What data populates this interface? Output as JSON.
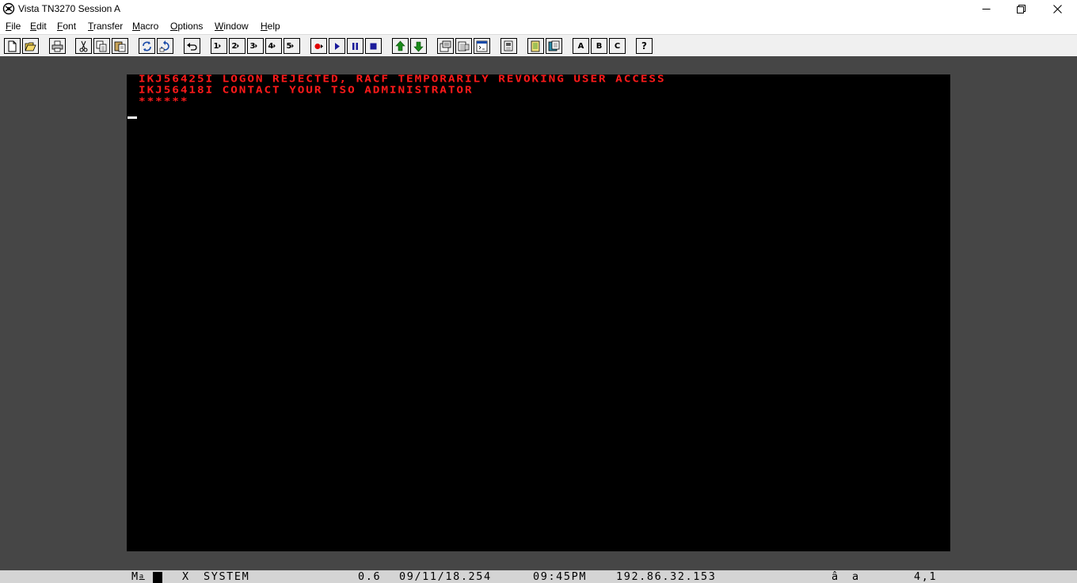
{
  "window": {
    "title": "Vista TN3270 Session A",
    "icon": "terminal-app-icon"
  },
  "menu": [
    {
      "label": "File",
      "key": "F",
      "rest": "ile"
    },
    {
      "label": "Edit",
      "key": "E",
      "rest": "dit"
    },
    {
      "label": "Font",
      "key": "F",
      "rest": "ont"
    },
    {
      "label": "Transfer",
      "key": "T",
      "rest": "ransfer"
    },
    {
      "label": "Macro",
      "key": "M",
      "rest": "acro"
    },
    {
      "label": "Options",
      "key": "O",
      "rest": "ptions"
    },
    {
      "label": "Window",
      "key": "W",
      "rest": "indow"
    },
    {
      "label": "Help",
      "key": "H",
      "rest": "elp"
    }
  ],
  "toolbar": {
    "macro_keys": [
      "1",
      "2",
      "3",
      "4",
      "5"
    ],
    "letter_keys": [
      "A",
      "B",
      "C"
    ],
    "help": "?"
  },
  "terminal": {
    "lines": [
      "IKJ56425I LOGON REJECTED, RACF TEMPORARILY REVOKING USER ACCESS",
      "IKJ56418I CONTACT YOUR TSO ADMINISTRATOR",
      "******"
    ],
    "text_color": "#ff1a1a",
    "background": "#000000"
  },
  "status": {
    "mode": "M",
    "mode_sup": "a",
    "indicator": "X",
    "system": "SYSTEM",
    "version": "0.6",
    "date": "09/11/18.254",
    "time": "09:45PM",
    "ip": "192.86.32.153",
    "shift_glyph": "â",
    "insert": "a",
    "cursor_pos": "4,1"
  }
}
